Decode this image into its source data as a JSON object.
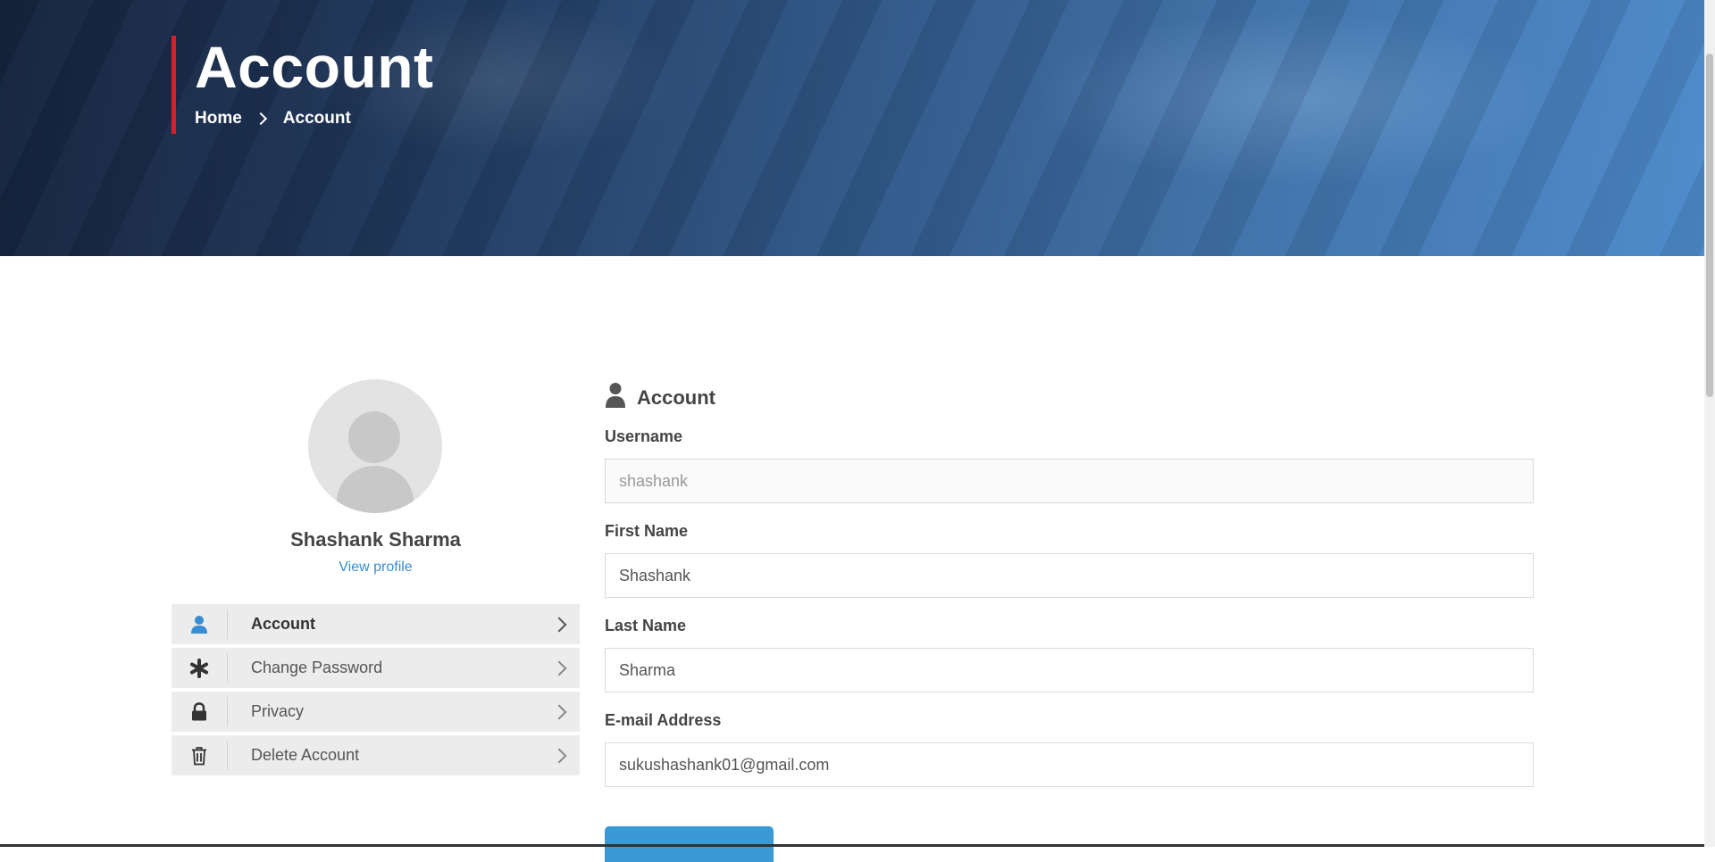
{
  "hero": {
    "title": "Account",
    "breadcrumb": [
      {
        "label": "Home"
      },
      {
        "label": "Account"
      }
    ]
  },
  "profile": {
    "name": "Shashank Sharma",
    "view_profile_label": "View profile"
  },
  "sidebar": {
    "items": [
      {
        "label": "Account",
        "icon": "user-icon",
        "active": true
      },
      {
        "label": "Change Password",
        "icon": "asterisk-icon",
        "active": false
      },
      {
        "label": "Privacy",
        "icon": "lock-icon",
        "active": false
      },
      {
        "label": "Delete Account",
        "icon": "trash-icon",
        "active": false
      }
    ]
  },
  "form": {
    "title": "Account",
    "title_icon": "user-icon",
    "fields": [
      {
        "label": "Username",
        "value": "",
        "placeholder": "shashank"
      },
      {
        "label": "First Name",
        "value": "Shashank",
        "placeholder": ""
      },
      {
        "label": "Last Name",
        "value": "Sharma",
        "placeholder": ""
      },
      {
        "label": "E-mail Address",
        "value": "sukushashank01@gmail.com",
        "placeholder": ""
      }
    ],
    "submit_label": ""
  },
  "colors": {
    "accent_red": "#d7202e",
    "link_blue": "#3a8dd0",
    "button_blue": "#3a9ad6",
    "active_icon_blue": "#3a8dd0",
    "menu_bg": "#ececec"
  }
}
